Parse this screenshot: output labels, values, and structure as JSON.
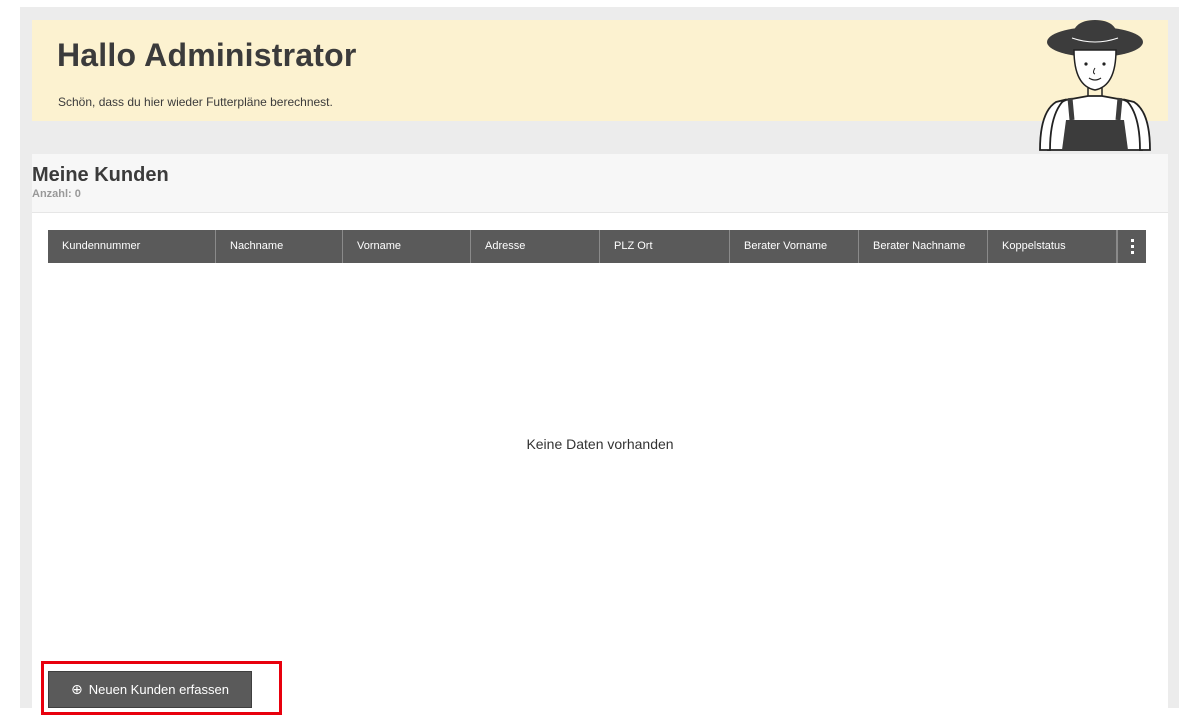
{
  "welcome": {
    "title": "Hallo Administrator",
    "subtitle": "Schön, dass du hier wieder Futterpläne berechnest."
  },
  "customers": {
    "title": "Meine Kunden",
    "count": "Anzahl: 0",
    "columns": [
      "Kundennummer",
      "Nachname",
      "Vorname",
      "Adresse",
      "PLZ Ort",
      "Berater Vorname",
      "Berater Nachname",
      "Koppelstatus"
    ],
    "empty_message": "Keine Daten vorhanden",
    "add_button": {
      "icon": "plus-circle-icon",
      "icon_glyph": "⊕",
      "label": "Neuen Kunden erfassen"
    }
  },
  "colors": {
    "welcome_bg": "#fcf2d0",
    "table_header_bg": "#5a5a5a",
    "highlight": "#e8000d"
  }
}
